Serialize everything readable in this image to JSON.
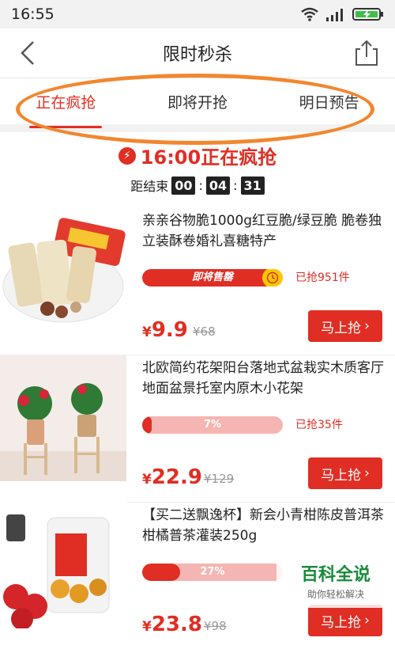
{
  "status_bar": {
    "time": "16:55"
  },
  "header": {
    "title": "限时秒杀"
  },
  "tabs": [
    {
      "label": "正在疯抢",
      "active": true
    },
    {
      "label": "即将开抢",
      "active": false
    },
    {
      "label": "明日预告",
      "active": false
    }
  ],
  "session": {
    "heading": "16:00正在疯抢",
    "ends_label": "距结束",
    "countdown": [
      "00",
      "04",
      "31"
    ]
  },
  "products": [
    {
      "title": "亲亲谷物脆1000g红豆脆/绿豆脆 脆卷独立装酥卷婚礼喜糖特产",
      "progress_label": "即将售罄",
      "progress": 0.95,
      "sold": "已抢951件",
      "price": "9.9",
      "original": "¥68",
      "buy": "马上抢"
    },
    {
      "title": "北欧简约花架阳台落地式盆栽实木质客厅地面盆景托室内原木小花架",
      "progress_label": "7%",
      "progress": 0.07,
      "sold": "已抢35件",
      "price": "22.9",
      "original": "¥129",
      "buy": "马上抢"
    },
    {
      "title": "【买二送飘逸杯】新会小青柑陈皮普洱茶柑橘普茶灌装250g",
      "progress_label": "27%",
      "progress": 0.27,
      "sold": "",
      "price": "23.8",
      "original": "¥98",
      "buy": "马上抢"
    }
  ],
  "currency": "¥",
  "watermark": {
    "main": "百科全说",
    "sub": "助你轻松解决"
  },
  "colors": {
    "accent": "#e02e24",
    "annotation": "#f2872e"
  }
}
